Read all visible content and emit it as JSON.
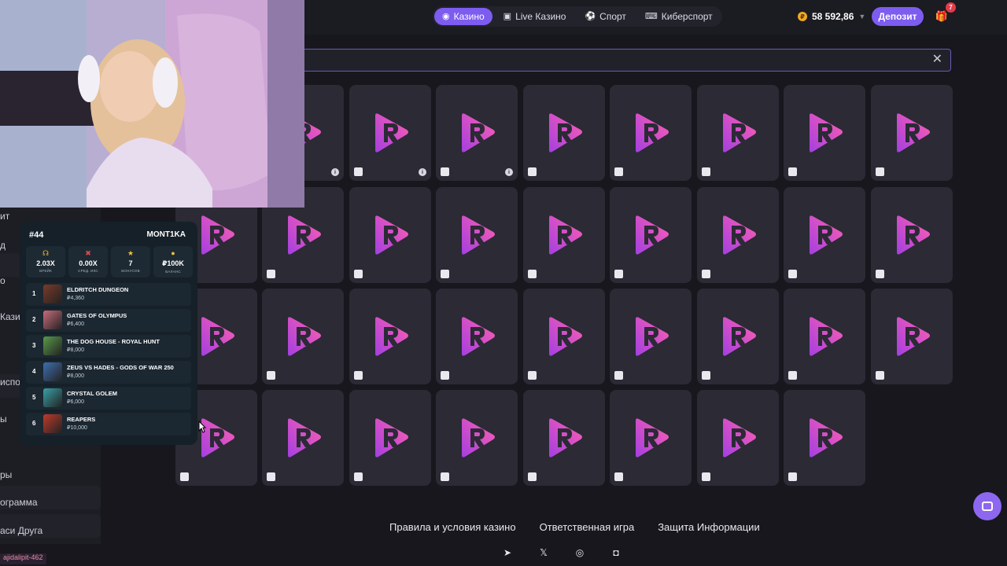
{
  "header": {
    "nav": [
      {
        "label": "Казино",
        "icon": "casino-icon",
        "active": true
      },
      {
        "label": "Live Казино",
        "icon": "live-casino-icon",
        "active": false
      },
      {
        "label": "Спорт",
        "icon": "sport-ball-icon",
        "active": false
      },
      {
        "label": "Киберспорт",
        "icon": "gamepad-icon",
        "active": false
      }
    ],
    "balance": "58 592,86",
    "balance_coin_symbol": "₽",
    "deposit_label": "Депозит",
    "notifications_count": "7"
  },
  "search": {
    "value": "",
    "placeholder": ""
  },
  "sidebar": {
    "items": [
      "ит",
      "д",
      "о",
      "Кази",
      "",
      "испор",
      "ы",
      "ры",
      "ограмма",
      "аси Друга"
    ],
    "referral_tag": "ajidalipit-462"
  },
  "leaderboard": {
    "rank": "#44",
    "username": "MONT1KA",
    "stats": [
      {
        "value": "2.03X",
        "label": "БРЕЙК",
        "icon": "headphones-icon"
      },
      {
        "value": "0.00X",
        "label": "СРЕД. ИКС",
        "icon": "cross-icon"
      },
      {
        "value": "7",
        "label": "БОНУСОВ",
        "icon": "star-icon"
      },
      {
        "value": "₽100K",
        "label": "БАЛАНС",
        "icon": "coin-icon"
      }
    ],
    "games": [
      {
        "num": "1",
        "name": "ELDRITCH DUNGEON",
        "bet": "₽4,360",
        "color": "#7a3a2a"
      },
      {
        "num": "2",
        "name": "GATES OF OLYMPUS",
        "bet": "₽6,400",
        "color": "#c86c7a"
      },
      {
        "num": "3",
        "name": "THE DOG HOUSE - ROYAL HUNT",
        "bet": "₽8,000",
        "color": "#5a9a4a"
      },
      {
        "num": "4",
        "name": "ZEUS VS HADES - GODS OF WAR 250",
        "bet": "₽8,000",
        "color": "#3f6fb0"
      },
      {
        "num": "5",
        "name": "CRYSTAL GOLEM",
        "bet": "₽6,000",
        "color": "#3aa0a6"
      },
      {
        "num": "6",
        "name": "REAPERS",
        "bet": "₽10,000",
        "color": "#c03a2a"
      }
    ]
  },
  "grid": {
    "provider_badges": [
      [
        "",
        "",
        "",
        "",
        "",
        "",
        "",
        "",
        ""
      ],
      [
        "",
        "",
        "",
        "",
        "",
        "",
        "",
        "",
        ""
      ],
      [
        "",
        "",
        "",
        "",
        "",
        "",
        "",
        "",
        ""
      ],
      [
        "",
        "",
        "",
        "",
        "",
        "",
        "",
        ""
      ]
    ]
  },
  "footer": {
    "links": [
      "Правила и условия казино",
      "Ответственная игра",
      "Защита Информации"
    ],
    "socials": [
      "telegram-icon",
      "x-icon",
      "instagram-icon",
      "discord-icon"
    ]
  },
  "colors": {
    "accent": "#7d5cf0",
    "background": "#17171d",
    "tile": "#2b2a35",
    "logo_from": "#a43fe0",
    "logo_to": "#ff5fb0"
  }
}
